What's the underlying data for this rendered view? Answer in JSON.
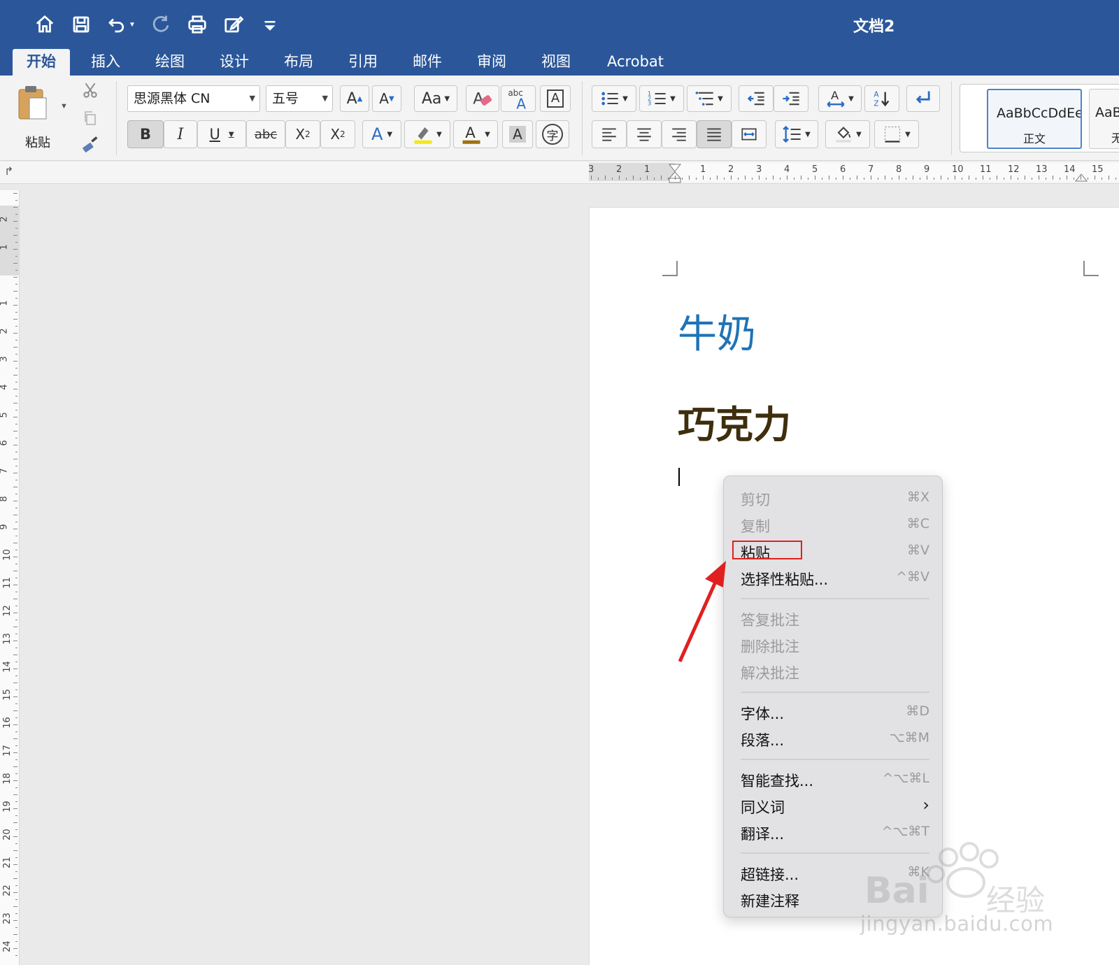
{
  "window": {
    "title": "文档2"
  },
  "quick_access": [
    "home-icon",
    "save-icon",
    "undo-icon",
    "redo-icon",
    "print-icon",
    "edit-icon",
    "customize-icon"
  ],
  "tabs": [
    {
      "label": "开始",
      "active": true
    },
    {
      "label": "插入"
    },
    {
      "label": "绘图"
    },
    {
      "label": "设计"
    },
    {
      "label": "布局"
    },
    {
      "label": "引用"
    },
    {
      "label": "邮件"
    },
    {
      "label": "审阅"
    },
    {
      "label": "视图"
    },
    {
      "label": "Acrobat"
    }
  ],
  "ribbon": {
    "paste_label": "粘贴",
    "font_name": "思源黑体 CN",
    "font_size": "五号",
    "styles": [
      {
        "sample": "AaBbCcDdEe",
        "name": "正文",
        "selected": true
      },
      {
        "sample": "AaBb",
        "name": "无"
      }
    ]
  },
  "ruler": {
    "h_numbers": [
      "3",
      "2",
      "1",
      "1",
      "2",
      "3",
      "4",
      "5",
      "6",
      "7",
      "8",
      "9",
      "10",
      "11",
      "12",
      "13",
      "14",
      "15",
      "1"
    ],
    "v_numbers": [
      "2",
      "1",
      "1",
      "2",
      "3",
      "4",
      "5",
      "6",
      "7",
      "8",
      "9",
      "10",
      "11",
      "12",
      "13",
      "14",
      "15",
      "16",
      "17",
      "18",
      "19",
      "20",
      "21",
      "22",
      "23",
      "24"
    ]
  },
  "document": {
    "heading1": "牛奶",
    "heading2": "巧克力"
  },
  "context_menu": {
    "items": [
      {
        "label": "剪切",
        "shortcut": "⌘X",
        "disabled": true
      },
      {
        "label": "复制",
        "shortcut": "⌘C",
        "disabled": true
      },
      {
        "label": "粘贴",
        "shortcut": "⌘V",
        "highlighted": true
      },
      {
        "label": "选择性粘贴...",
        "shortcut": "^⌘V"
      },
      {
        "label": "答复批注",
        "disabled": true
      },
      {
        "label": "删除批注",
        "disabled": true
      },
      {
        "label": "解决批注",
        "disabled": true
      },
      {
        "label": "字体...",
        "shortcut": "⌘D"
      },
      {
        "label": "段落...",
        "shortcut": "⌥⌘M"
      },
      {
        "label": "智能查找...",
        "shortcut": "^⌥⌘L"
      },
      {
        "label": "同义词",
        "submenu": true
      },
      {
        "label": "翻译...",
        "shortcut": "^⌥⌘T"
      },
      {
        "label": "超链接...",
        "shortcut": "⌘K"
      },
      {
        "label": "新建注释"
      }
    ]
  },
  "annotation": {
    "highlight_color": "#e02020"
  },
  "watermark": {
    "brand": "Bai",
    "brand2": "经验",
    "url": "jingyan.baidu.com"
  },
  "colors": {
    "accent": "#2b579a",
    "heading1": "#1f73b7",
    "heading2": "#3e2e0d"
  }
}
